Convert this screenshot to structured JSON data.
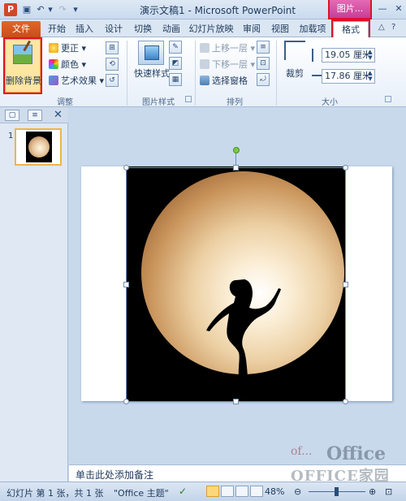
{
  "titlebar": {
    "app_icon": "P",
    "title": "演示文稿1 - Microsoft PowerPoint",
    "context_tab": "图片...",
    "qat": {
      "save_icon": "save-icon",
      "undo_icon": "undo-icon",
      "redo_icon": "redo-icon"
    }
  },
  "tabs": {
    "file": "文件",
    "items": [
      "开始",
      "插入",
      "设计",
      "切换",
      "动画",
      "幻灯片放映",
      "审阅",
      "视图",
      "加载项"
    ],
    "format": "格式"
  },
  "ribbon": {
    "adjust": {
      "remove_bg": "删除背景",
      "corrections": "更正",
      "color": "颜色",
      "artistic": "艺术效果",
      "label": "调整"
    },
    "picture_styles": {
      "quick_styles": "快速样式",
      "label": "图片样式"
    },
    "arrange": {
      "bring_forward": "上移一层",
      "send_backward": "下移一层",
      "selection_pane": "选择窗格",
      "label": "排列"
    },
    "size": {
      "crop": "裁剪",
      "height": "19.05 厘米",
      "width": "17.86 厘米",
      "label": "大小"
    }
  },
  "thumbnails": {
    "slide_number": "1"
  },
  "notes": {
    "placeholder": "单击此处添加备注"
  },
  "watermark": {
    "line1": "of...",
    "line2": "Office",
    "line3": "OFFICE家园"
  },
  "status": {
    "slide_info": "幻灯片 第 1 张，共 1 张",
    "theme": "\"Office 主题\"",
    "zoom": "48%"
  }
}
